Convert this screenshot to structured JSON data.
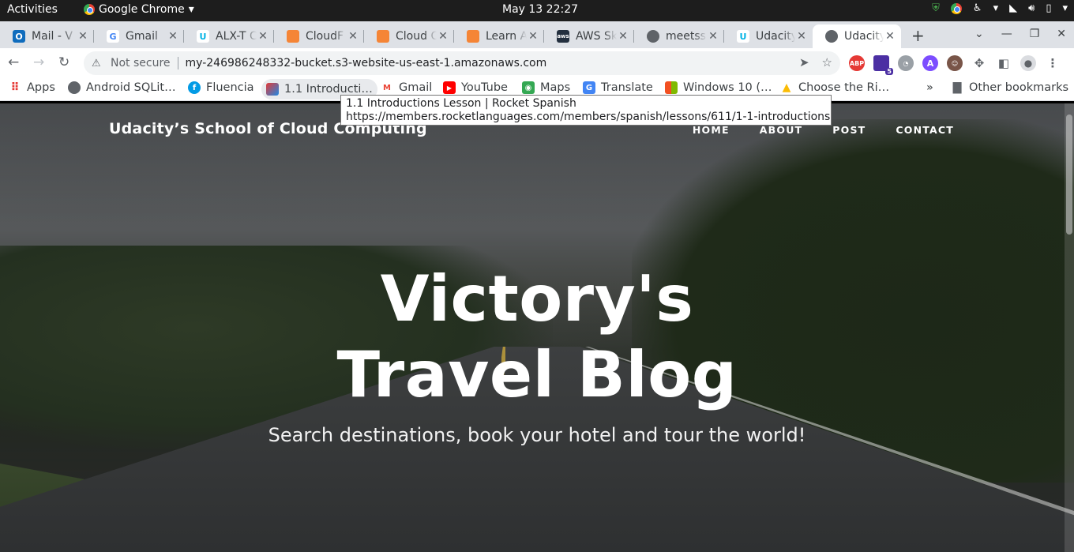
{
  "topbar": {
    "activities": "Activities",
    "app_name": "Google Chrome",
    "clock": "May 13  22:27"
  },
  "tabs": [
    {
      "title": "Mail - V",
      "icon": "outlook-icon",
      "color": "#0f6cbd"
    },
    {
      "title": "Gmail",
      "icon": "google-icon",
      "color": "#4285f4"
    },
    {
      "title": "ALX-T C",
      "icon": "udacity-icon",
      "color": "#02b3e4"
    },
    {
      "title": "CloudF",
      "icon": "aws-cube-icon",
      "color": "#f58536"
    },
    {
      "title": "Cloud C",
      "icon": "aws-cube-icon",
      "color": "#f58536"
    },
    {
      "title": "Learn A",
      "icon": "aws-cube-icon",
      "color": "#f58536"
    },
    {
      "title": "AWS Sk",
      "icon": "aws-logo-icon",
      "color": "#232f3e"
    },
    {
      "title": "meetss",
      "icon": "globe-icon",
      "color": "#5f6368"
    },
    {
      "title": "Udacity",
      "icon": "udacity-icon",
      "color": "#02b3e4"
    },
    {
      "title": "Udacity",
      "icon": "globe-icon",
      "color": "#5f6368"
    }
  ],
  "toolbar": {
    "security_label": "Not secure",
    "url": "my-246986248332-bucket.s3-website-us-east-1.amazonaws.com",
    "extension_badge": "5"
  },
  "bookmarks": {
    "apps": "Apps",
    "items": [
      "Android SQLit…",
      "Fluencia",
      "1.1 Introducti…",
      "Gmail",
      "YouTube",
      "Maps",
      "Translate",
      "Windows 10 (…",
      "Choose the Ri…"
    ],
    "overflow": "»",
    "other": "Other bookmarks"
  },
  "tooltip": {
    "title": "1.1 Introductions Lesson | Rocket Spanish",
    "url": "https://members.rocketlanguages.com/members/spanish/lessons/611/1-1-introductions"
  },
  "site": {
    "brand": "Udacity’s School of Cloud Computing",
    "menu": [
      "HOME",
      "ABOUT",
      "POST",
      "CONTACT"
    ],
    "hero_title": "Victory's Travel Blog",
    "hero_subtitle": "Search destinations, book your hotel and tour the world!"
  }
}
